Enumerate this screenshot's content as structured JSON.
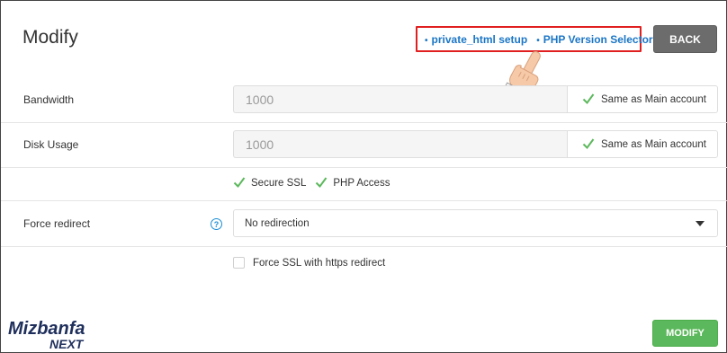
{
  "page": {
    "title": "Modify",
    "back_label": "BACK",
    "modify_label": "MODIFY"
  },
  "links": {
    "private_html": "private_html setup",
    "php_selector": "PHP Version Selector",
    "bullet": "•"
  },
  "form": {
    "bandwidth": {
      "label": "Bandwidth",
      "value": "1000",
      "same_label": "Same as Main account",
      "same_checked": true
    },
    "disk_usage": {
      "label": "Disk Usage",
      "value": "1000",
      "same_label": "Same as Main account",
      "same_checked": true
    },
    "options": {
      "secure_ssl": "Secure SSL",
      "secure_ssl_checked": true,
      "php_access": "PHP Access",
      "php_access_checked": true
    },
    "force_redirect": {
      "label": "Force redirect",
      "help": "?",
      "selected": "No redirection"
    },
    "force_ssl": {
      "label": "Force SSL with https redirect",
      "checked": false
    }
  },
  "logo": {
    "line1": "Mizbanfa",
    "line2": "NEXT"
  },
  "colors": {
    "link": "#1b76c6",
    "highlight_box": "#e02020",
    "check": "#5cb85c",
    "back_button": "#6c6c6c",
    "modify_button": "#5cb85c"
  },
  "icons": {
    "pointer": "hand-pointer-icon",
    "check": "checkmark-icon",
    "help": "question-circle-icon",
    "dropdown": "caret-down-icon"
  }
}
